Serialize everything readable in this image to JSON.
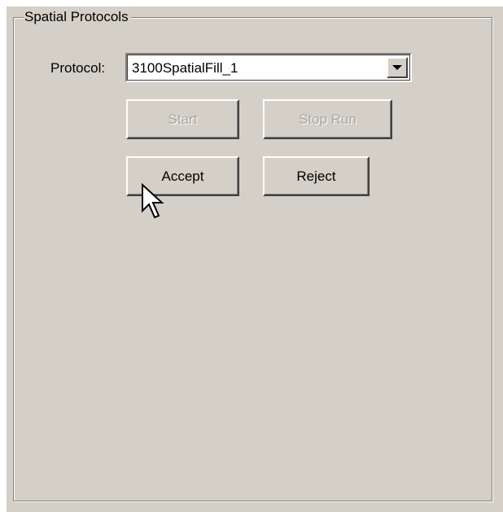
{
  "group": {
    "title": "Spatial Protocols"
  },
  "protocol": {
    "label": "Protocol:",
    "selected": "3100SpatialFill_1"
  },
  "buttons": {
    "start": "Start",
    "stop_run": "Stop Run",
    "accept": "Accept",
    "reject": "Reject"
  },
  "state": {
    "start_enabled": false,
    "stop_run_enabled": false,
    "accept_enabled": true,
    "reject_enabled": true
  },
  "colors": {
    "panel_background": "#d4d0c8",
    "disabled_text": "#a8a6a0"
  },
  "icons": {
    "dropdown": "chevron-down-icon",
    "cursor": "mouse-pointer-icon"
  }
}
